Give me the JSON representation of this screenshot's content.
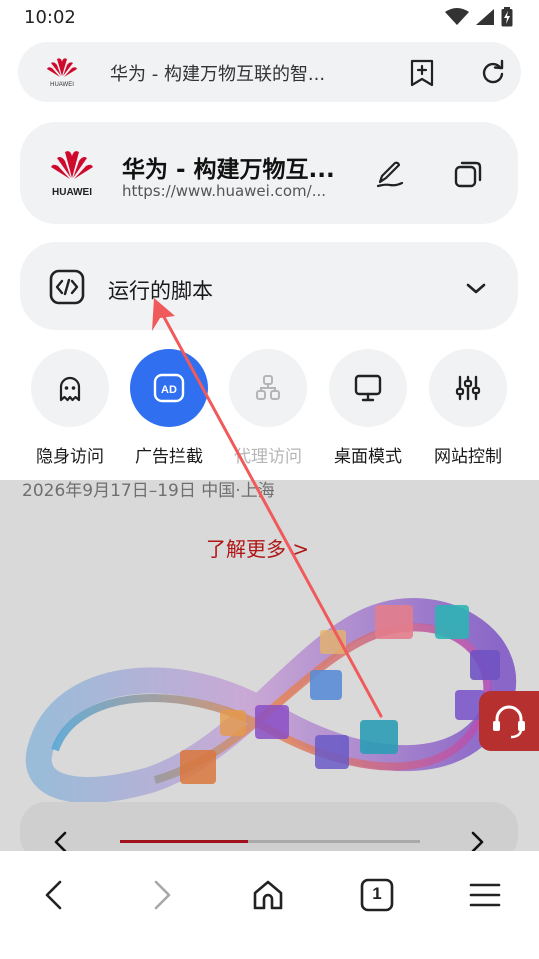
{
  "status_bar": {
    "time": "10:02"
  },
  "address_bar": {
    "title": "华为 - 构建万物互联的智..."
  },
  "site_card": {
    "title": "华为 - 构建万物互...",
    "url": "https://www.huawei.com/..."
  },
  "scripts": {
    "label": "运行的脚本"
  },
  "quick_actions": [
    {
      "label": "隐身访问",
      "icon": "ghost-icon",
      "active": false,
      "disabled": false
    },
    {
      "label": "广告拦截",
      "icon": "ad-block-icon",
      "active": true,
      "disabled": false
    },
    {
      "label": "代理访问",
      "icon": "proxy-icon",
      "active": false,
      "disabled": true
    },
    {
      "label": "桌面模式",
      "icon": "desktop-icon",
      "active": false,
      "disabled": false
    },
    {
      "label": "网站控制",
      "icon": "sliders-icon",
      "active": false,
      "disabled": false
    }
  ],
  "webpage": {
    "date_line": "2026年9月17日–19日    中国·上海",
    "learn_more": "了解更多 >"
  },
  "bottom_nav": {
    "tab_count": "1"
  },
  "colors": {
    "accent": "#2f6ff0",
    "huawei_red": "#cf0a2c",
    "card_bg": "#f1f2f4",
    "annotation_arrow": "#f05a5a"
  }
}
